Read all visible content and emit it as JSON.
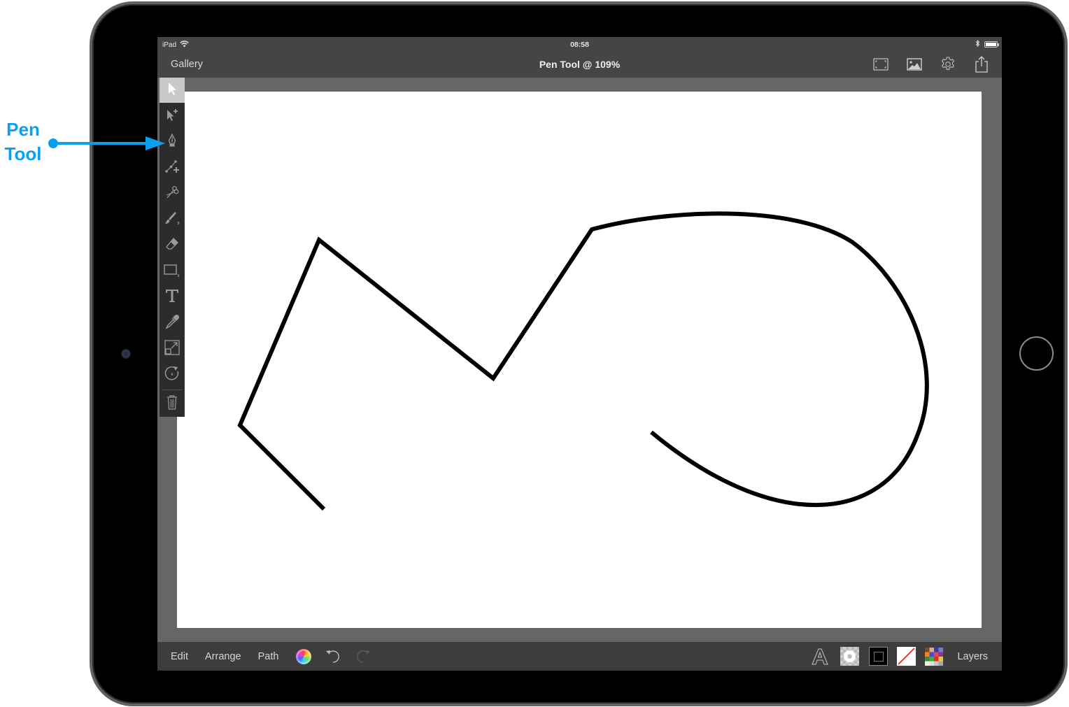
{
  "status_bar": {
    "carrier": "iPad",
    "time": "08:58",
    "wifi_icon": "wifi-icon",
    "bluetooth_icon": "bluetooth-icon",
    "battery_icon": "battery-icon"
  },
  "navbar": {
    "gallery_label": "Gallery",
    "title": "Pen Tool @ 109%",
    "icons": [
      "fit-to-screen-icon",
      "image-icon",
      "settings-gear-icon",
      "share-icon"
    ]
  },
  "toolbar": {
    "active_tool": "select",
    "tools": [
      {
        "id": "select",
        "icon": "arrow-select-icon"
      },
      {
        "id": "direct-select",
        "icon": "arrow-plus-icon"
      },
      {
        "id": "pen",
        "icon": "pen-nib-icon"
      },
      {
        "id": "add-anchor",
        "icon": "node-plus-icon"
      },
      {
        "id": "scissors",
        "icon": "scissors-icon"
      },
      {
        "id": "brush",
        "icon": "brush-icon"
      },
      {
        "id": "eraser",
        "icon": "eraser-icon"
      },
      {
        "id": "shape",
        "icon": "rectangle-icon"
      },
      {
        "id": "text",
        "icon": "text-t-icon"
      },
      {
        "id": "eyedropper",
        "icon": "eyedropper-icon"
      },
      {
        "id": "scale",
        "icon": "scale-icon"
      },
      {
        "id": "rotate",
        "icon": "rotate-icon"
      },
      {
        "id": "delete",
        "icon": "trash-icon"
      }
    ]
  },
  "bottom_bar": {
    "edit_label": "Edit",
    "arrange_label": "Arrange",
    "path_label": "Path",
    "layers_label": "Layers",
    "icons": [
      "color-wheel-icon",
      "undo-icon",
      "redo-icon",
      "font-icon",
      "opacity-icon",
      "stroke-icon",
      "fill-none-icon",
      "swatches-icon"
    ]
  },
  "annotation": {
    "line1": "Pen",
    "line2": "Tool",
    "color": "#0ba0ef"
  },
  "colors": {
    "screen_bg": "#454545",
    "canvas_bg": "#666666",
    "toolbar_bg": "#2c2c2c",
    "stroke": "#000000",
    "accent_annotation": "#0ba0ef"
  }
}
